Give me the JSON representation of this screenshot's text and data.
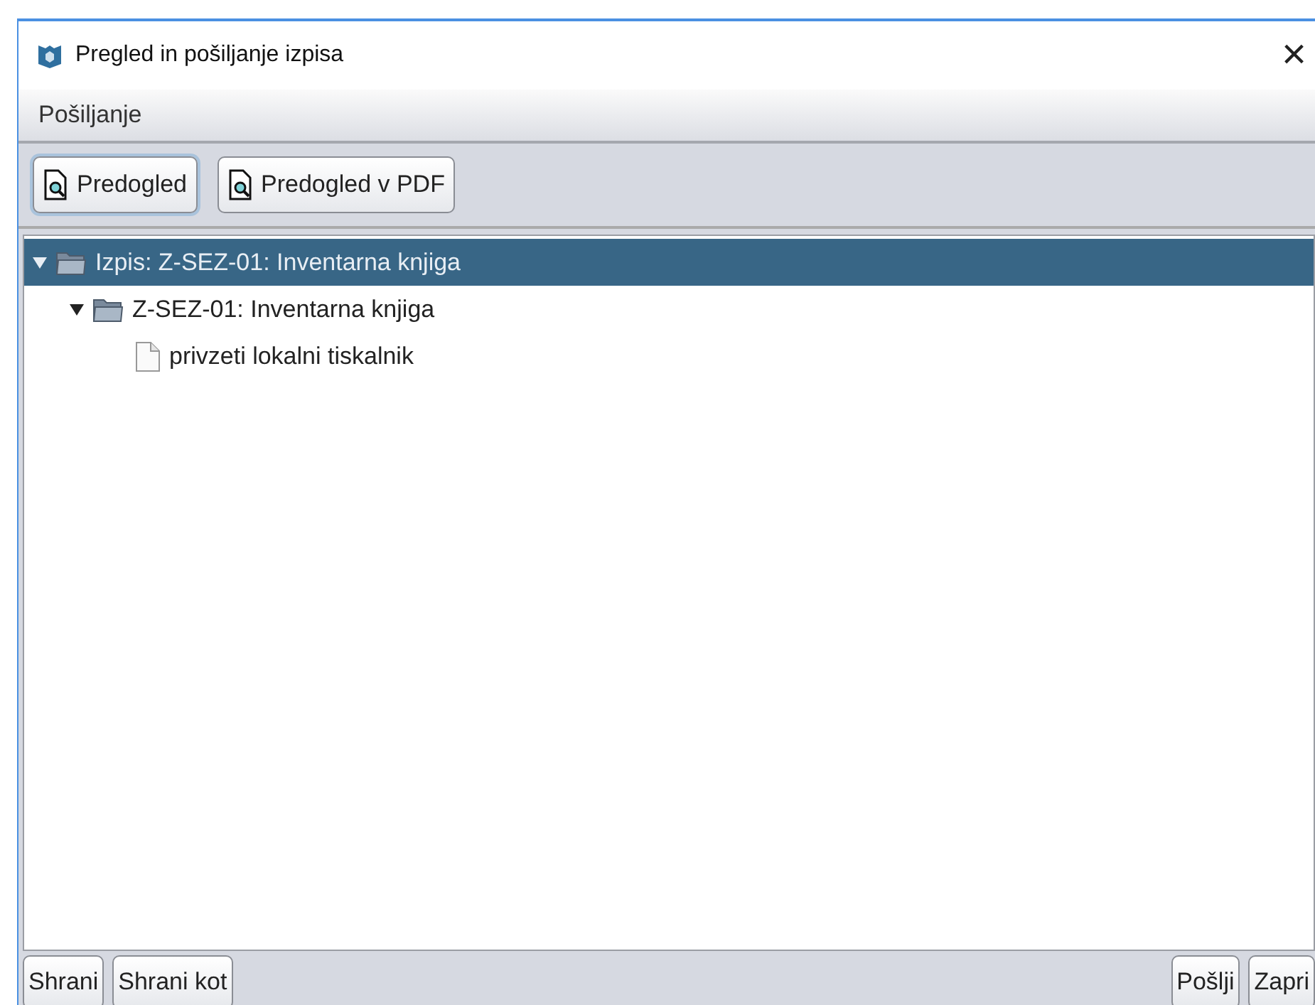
{
  "window": {
    "title": "Pregled in pošiljanje izpisa",
    "close": "×"
  },
  "menu": [
    "Pošiljanje"
  ],
  "toolbar": [
    {
      "label": "Predogled",
      "focused": true
    },
    {
      "label": "Predogled v PDF",
      "focused": false
    }
  ],
  "tree": [
    {
      "kind": "folder",
      "label": "Izpis: Z-SEZ-01: Inventarna knjiga",
      "expanded": true,
      "selected": true,
      "children": [
        {
          "kind": "folder",
          "label": "Z-SEZ-01: Inventarna knjiga",
          "expanded": true,
          "selected": false,
          "children": [
            {
              "kind": "file",
              "label": "privzeti lokalni tiskalnik",
              "selected": false
            }
          ]
        }
      ]
    }
  ],
  "buttons_left": [
    "Shrani",
    "Shrani kot"
  ],
  "buttons_right": [
    "Pošlji",
    "Zapri"
  ]
}
